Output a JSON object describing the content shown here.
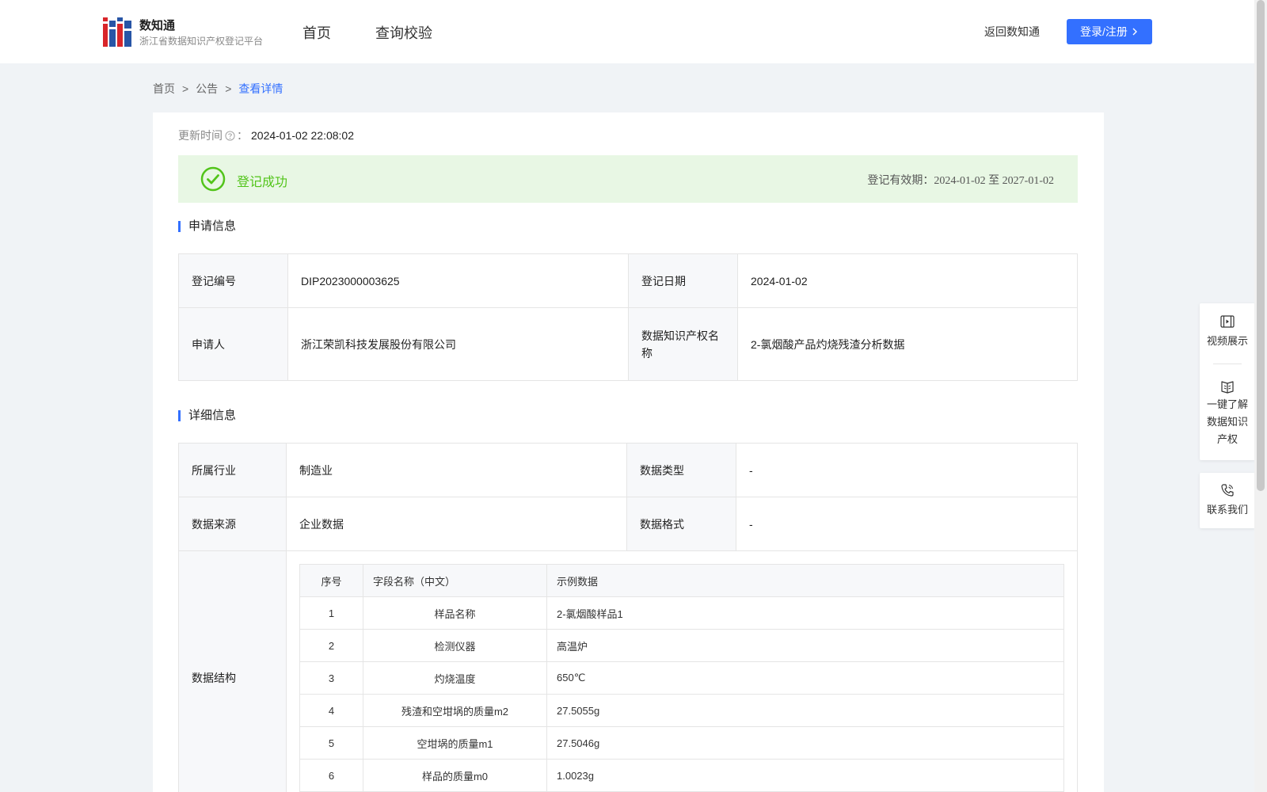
{
  "header": {
    "logo_name": "数知通",
    "logo_sub": "浙江省数据知识产权登记平台",
    "nav": [
      "首页",
      "查询校验"
    ],
    "back_link": "返回数知通",
    "login_label": "登录/注册"
  },
  "breadcrumb": {
    "items": [
      "首页",
      "公告",
      "查看详情"
    ],
    "separator": ">"
  },
  "update": {
    "label": "更新时间",
    "colon": "：",
    "value": "2024-01-02 22:08:02"
  },
  "status": {
    "text": "登记成功",
    "validity_label": "登记有效期：",
    "validity_start": "2024-01-02",
    "validity_to": "至",
    "validity_end": "2027-01-02",
    "color": "#52c41a"
  },
  "apply_info": {
    "title": "申请信息",
    "reg_no_label": "登记编号",
    "reg_no": "DIP2023000003625",
    "reg_date_label": "登记日期",
    "reg_date": "2024-01-02",
    "applicant_label": "申请人",
    "applicant": "浙江荣凯科技发展股份有限公司",
    "ip_name_label": "数据知识产权名称",
    "ip_name": "2-氯烟酸产品灼烧残渣分析数据"
  },
  "detail_info": {
    "title": "详细信息",
    "industry_label": "所属行业",
    "industry": "制造业",
    "data_type_label": "数据类型",
    "data_type": "-",
    "source_label": "数据来源",
    "source": "企业数据",
    "format_label": "数据格式",
    "format": "-",
    "structure_label": "数据结构",
    "structure": {
      "headers": [
        "序号",
        "字段名称（中文）",
        "示例数据"
      ],
      "rows": [
        [
          "1",
          "样品名称",
          "2-氯烟酸样品1"
        ],
        [
          "2",
          "检测仪器",
          "高温炉"
        ],
        [
          "3",
          "灼烧温度",
          "650℃"
        ],
        [
          "4",
          "残渣和空坩埚的质量m2",
          "27.5055g"
        ],
        [
          "5",
          "空坩埚的质量m1",
          "27.5046g"
        ],
        [
          "6",
          "样品的质量m0",
          "1.0023g"
        ]
      ]
    }
  },
  "side_panel": {
    "video": "视频展示",
    "learn_1": "一键了解",
    "learn_2": "数据知识",
    "learn_3": "产权",
    "contact": "联系我们"
  },
  "colors": {
    "accent": "#3370ff",
    "success_bg": "#e8f7e4",
    "logo_red": "#d9252a",
    "logo_blue": "#2855a6"
  }
}
